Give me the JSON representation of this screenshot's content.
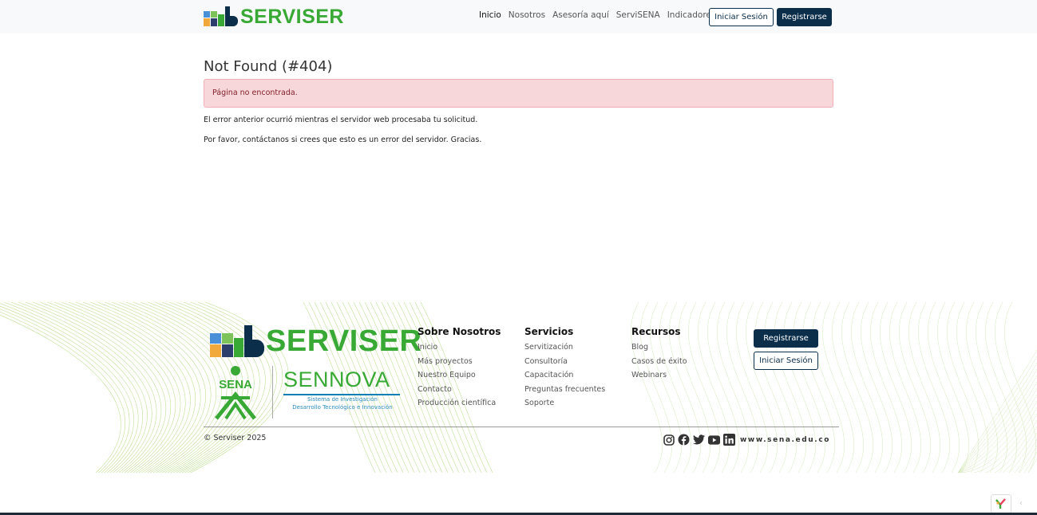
{
  "brand": {
    "name": "SERVISER",
    "color": "#39a935",
    "dark": "#0b2e4b"
  },
  "nav": {
    "links": [
      "Inicio",
      "Nosotros",
      "Asesoría aquí",
      "ServiSENA",
      "Indicadores"
    ],
    "login_label": "Iniciar Sesión",
    "register_label": "Registrarse"
  },
  "main": {
    "title": "Not Found (#404)",
    "alert": "Página no encontrada.",
    "message1": "El error anterior ocurrió mientras el servidor web procesaba tu solicitud.",
    "message2": "Por favor, contáctanos si crees que esto es un error del servidor. Gracias."
  },
  "footer": {
    "logo_text": "SERVISER",
    "sena_label": "SENA",
    "sennova_title": "SENNOVA",
    "sennova_sub1": "Sistema de Investigación",
    "sennova_sub2": "Desarrollo Tecnológico e Innovación",
    "columns": [
      {
        "title": "Sobre Nosotros",
        "items": [
          "Inicio",
          "Más proyectos",
          "Nuestro Equipo",
          "Contacto",
          "Producción científica"
        ]
      },
      {
        "title": "Servicios",
        "items": [
          "Servitización",
          "Consultoría",
          "Capacitación",
          "Preguntas frecuentes",
          "Soporte"
        ]
      },
      {
        "title": "Recursos",
        "items": [
          "Blog",
          "Casos de éxito",
          "Webinars"
        ]
      }
    ],
    "register_label": "Registrarse",
    "login_label": "Iniciar Sesión",
    "copyright": "© Serviser 2025",
    "social_icons": [
      "instagram-icon",
      "facebook-icon",
      "twitter-icon",
      "youtube-icon",
      "linkedin-icon"
    ],
    "site_url": "www.sena.edu.co"
  },
  "widget": {
    "arrow": "‹"
  }
}
